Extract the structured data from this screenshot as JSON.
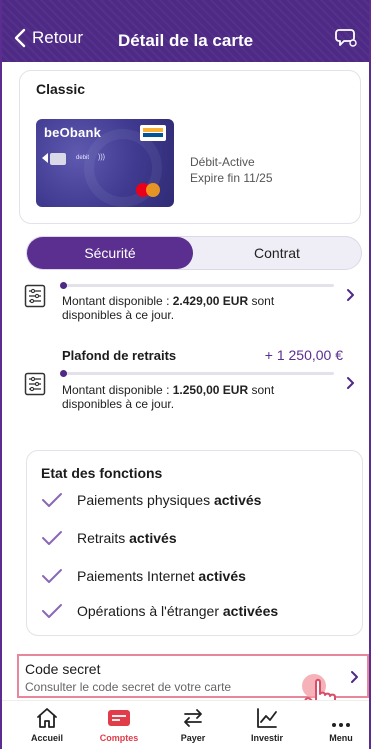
{
  "header": {
    "back_label": "Retour",
    "title": "Détail de la carte"
  },
  "card": {
    "name": "Classic",
    "brand": "beObank",
    "debit_text": "debit",
    "status_line1": "Débit-Active",
    "status_line2": "Expire fin 11/25"
  },
  "tabs": [
    {
      "label": "Sécurité",
      "active": true
    },
    {
      "label": "Contrat",
      "active": false
    }
  ],
  "limits": [
    {
      "title": "",
      "amount": "",
      "fill_fraction": 0.02,
      "text_prefix": "Montant disponible : ",
      "text_value": "2.429,00 EUR",
      "text_suffix": " sont disponibles à ce jour."
    },
    {
      "title": "Plafond de retraits",
      "amount": "+ 1 250,00 €",
      "fill_fraction": 0.02,
      "text_prefix": "Montant disponible : ",
      "text_value": "1.250,00 EUR",
      "text_suffix": " sont disponibles à ce jour."
    }
  ],
  "functions": {
    "title": "Etat des fonctions",
    "items": [
      {
        "label": "Paiements physiques ",
        "state": "activés"
      },
      {
        "label": "Retraits ",
        "state": "activés"
      },
      {
        "label": "Paiements Internet ",
        "state": "activés"
      },
      {
        "label": "Opérations à l'étranger ",
        "state": "activées"
      }
    ]
  },
  "code_secret": {
    "title": "Code secret",
    "subtitle": "Consulter le code secret de votre carte"
  },
  "nav": [
    {
      "label": "Accueil",
      "icon": "home-icon",
      "active": false
    },
    {
      "label": "Comptes",
      "icon": "accounts-icon",
      "active": true
    },
    {
      "label": "Payer",
      "icon": "transfer-icon",
      "active": false
    },
    {
      "label": "Investir",
      "icon": "chart-icon",
      "active": false
    },
    {
      "label": "Menu",
      "icon": "menu-icon",
      "active": false
    }
  ],
  "colors": {
    "brand_purple": "#4e2a86",
    "active_red": "#e03c49",
    "highlight_pink": "#e8879c"
  }
}
